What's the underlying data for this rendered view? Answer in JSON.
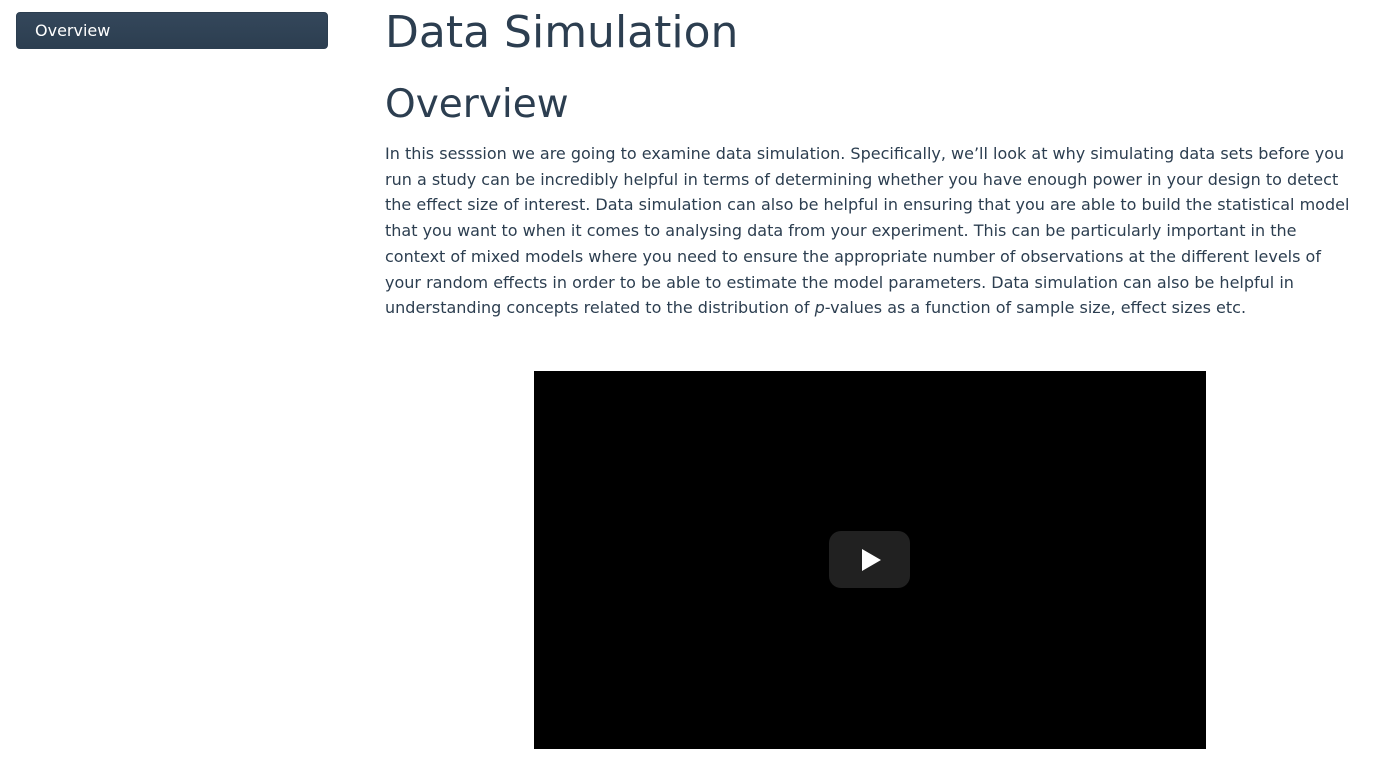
{
  "toc": {
    "items": [
      {
        "label": "Overview"
      }
    ]
  },
  "main": {
    "title": "Data Simulation",
    "section_title": "Overview",
    "intro": {
      "part1": "In this sesssion we are going to examine data simulation. Specifically, we’ll look at why simulating data sets before you run a study can be incredibly helpful in terms of determining whether you have enough power in your design to detect the effect size of interest. Data simulation can also be helpful in ensuring that you are able to build the statistical model that you want to when it comes to analysing data from your experiment. This can be particularly important in the context of mixed models where you need to ensure the appropriate number of observations at the different levels of your random effects in order to be able to estimate the model parameters. Data simulation can also be helpful in understanding concepts related to the distribution of ",
      "italic": "p",
      "part2": "-values as a function of sample size, effect sizes etc."
    }
  },
  "video": {
    "play_icon": "play-icon",
    "background_color": "#000000"
  },
  "colors": {
    "text": "#2c3e50",
    "toc_active_bg": "#2c3e50"
  }
}
